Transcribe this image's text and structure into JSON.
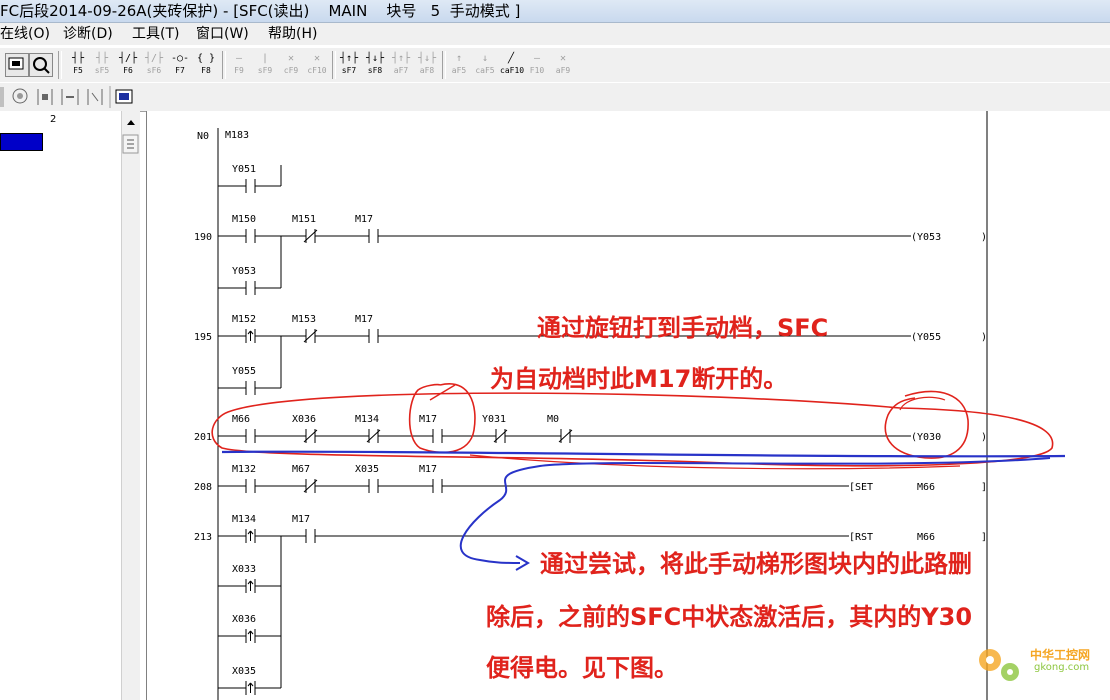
{
  "window": {
    "title": "FC后段2014-09-26A(夹砖保护) - [SFC(读出)    MAIN    块号   5  手动模式 ]"
  },
  "menu": [
    "在线(O)",
    "诊断(D)",
    "工具(T)",
    "窗口(W)",
    "帮助(H)"
  ],
  "toolbar1": {
    "buttons": [
      {
        "glyph": "┤├",
        "key": "F5",
        "enabled": true
      },
      {
        "glyph": "┤├",
        "key": "sF5",
        "enabled": false
      },
      {
        "glyph": "┤/├",
        "key": "F6",
        "enabled": true
      },
      {
        "glyph": "┤/├",
        "key": "sF6",
        "enabled": false
      },
      {
        "glyph": "-○-",
        "key": "F7",
        "enabled": true
      },
      {
        "glyph": "{ }",
        "key": "F8",
        "enabled": true
      },
      {
        "glyph": "—",
        "key": "F9",
        "enabled": false
      },
      {
        "glyph": "|",
        "key": "sF9",
        "enabled": false
      },
      {
        "glyph": "✕",
        "key": "cF9",
        "enabled": false
      },
      {
        "glyph": "✕",
        "key": "cF10",
        "enabled": false
      },
      {
        "glyph": "┤↑├",
        "key": "sF7",
        "enabled": true
      },
      {
        "glyph": "┤↓├",
        "key": "sF8",
        "enabled": true
      },
      {
        "glyph": "┤↑├",
        "key": "aF7",
        "enabled": false
      },
      {
        "glyph": "┤↓├",
        "key": "aF8",
        "enabled": false
      },
      {
        "glyph": "↑",
        "key": "aF5",
        "enabled": false
      },
      {
        "glyph": "↓",
        "key": "caF5",
        "enabled": false
      },
      {
        "glyph": "╱",
        "key": "caF10",
        "enabled": true
      },
      {
        "glyph": "—",
        "key": "F10",
        "enabled": false
      },
      {
        "glyph": "✕",
        "key": "aF9",
        "enabled": false
      }
    ]
  },
  "left_pane": {
    "column_number": "2"
  },
  "ladder": {
    "rung_labels": [
      "N0",
      "190",
      "195",
      "201",
      "208",
      "213"
    ],
    "contacts": [
      "M183",
      "Y051",
      "M150",
      "M151",
      "M17",
      "Y053",
      "M152",
      "M153",
      "M17",
      "Y055",
      "M66",
      "X036",
      "M134",
      "M17",
      "Y031",
      "M0",
      "M132",
      "M67",
      "X035",
      "M17",
      "M134",
      "M17",
      "X033",
      "X036",
      "X035"
    ],
    "coils": [
      "(Y053",
      "(Y055",
      "(Y030",
      "[SET",
      "M66",
      "[RST",
      "M66"
    ]
  },
  "annotations": {
    "red_line1": "通过旋钮打到手动档，SFC",
    "red_line2": "为自动档时此M17断开的。",
    "blue_line1": "通过尝试，将此手动梯形图块内的此路删",
    "blue_line2": "除后，之前的SFC中状态激活后，其内的Y30",
    "blue_line3": "便得电。见下图。"
  },
  "watermark": {
    "line1": "中华工控网",
    "line2": "gkong.com"
  },
  "colors": {
    "annotation_red": "#e0231c",
    "annotation_blue": "#2833c8",
    "highlight": "#0000c8"
  }
}
